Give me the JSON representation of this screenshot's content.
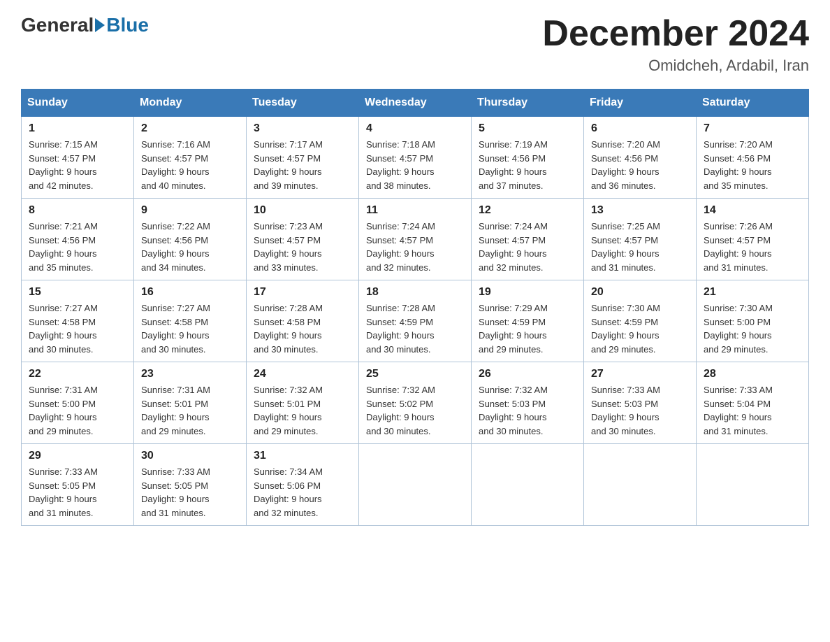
{
  "header": {
    "logo": {
      "general": "General",
      "blue": "Blue"
    },
    "title": "December 2024",
    "location": "Omidcheh, Ardabil, Iran"
  },
  "weekdays": [
    "Sunday",
    "Monday",
    "Tuesday",
    "Wednesday",
    "Thursday",
    "Friday",
    "Saturday"
  ],
  "weeks": [
    [
      {
        "day": "1",
        "sunrise": "7:15 AM",
        "sunset": "4:57 PM",
        "daylight": "9 hours and 42 minutes."
      },
      {
        "day": "2",
        "sunrise": "7:16 AM",
        "sunset": "4:57 PM",
        "daylight": "9 hours and 40 minutes."
      },
      {
        "day": "3",
        "sunrise": "7:17 AM",
        "sunset": "4:57 PM",
        "daylight": "9 hours and 39 minutes."
      },
      {
        "day": "4",
        "sunrise": "7:18 AM",
        "sunset": "4:57 PM",
        "daylight": "9 hours and 38 minutes."
      },
      {
        "day": "5",
        "sunrise": "7:19 AM",
        "sunset": "4:56 PM",
        "daylight": "9 hours and 37 minutes."
      },
      {
        "day": "6",
        "sunrise": "7:20 AM",
        "sunset": "4:56 PM",
        "daylight": "9 hours and 36 minutes."
      },
      {
        "day": "7",
        "sunrise": "7:20 AM",
        "sunset": "4:56 PM",
        "daylight": "9 hours and 35 minutes."
      }
    ],
    [
      {
        "day": "8",
        "sunrise": "7:21 AM",
        "sunset": "4:56 PM",
        "daylight": "9 hours and 35 minutes."
      },
      {
        "day": "9",
        "sunrise": "7:22 AM",
        "sunset": "4:56 PM",
        "daylight": "9 hours and 34 minutes."
      },
      {
        "day": "10",
        "sunrise": "7:23 AM",
        "sunset": "4:57 PM",
        "daylight": "9 hours and 33 minutes."
      },
      {
        "day": "11",
        "sunrise": "7:24 AM",
        "sunset": "4:57 PM",
        "daylight": "9 hours and 32 minutes."
      },
      {
        "day": "12",
        "sunrise": "7:24 AM",
        "sunset": "4:57 PM",
        "daylight": "9 hours and 32 minutes."
      },
      {
        "day": "13",
        "sunrise": "7:25 AM",
        "sunset": "4:57 PM",
        "daylight": "9 hours and 31 minutes."
      },
      {
        "day": "14",
        "sunrise": "7:26 AM",
        "sunset": "4:57 PM",
        "daylight": "9 hours and 31 minutes."
      }
    ],
    [
      {
        "day": "15",
        "sunrise": "7:27 AM",
        "sunset": "4:58 PM",
        "daylight": "9 hours and 30 minutes."
      },
      {
        "day": "16",
        "sunrise": "7:27 AM",
        "sunset": "4:58 PM",
        "daylight": "9 hours and 30 minutes."
      },
      {
        "day": "17",
        "sunrise": "7:28 AM",
        "sunset": "4:58 PM",
        "daylight": "9 hours and 30 minutes."
      },
      {
        "day": "18",
        "sunrise": "7:28 AM",
        "sunset": "4:59 PM",
        "daylight": "9 hours and 30 minutes."
      },
      {
        "day": "19",
        "sunrise": "7:29 AM",
        "sunset": "4:59 PM",
        "daylight": "9 hours and 29 minutes."
      },
      {
        "day": "20",
        "sunrise": "7:30 AM",
        "sunset": "4:59 PM",
        "daylight": "9 hours and 29 minutes."
      },
      {
        "day": "21",
        "sunrise": "7:30 AM",
        "sunset": "5:00 PM",
        "daylight": "9 hours and 29 minutes."
      }
    ],
    [
      {
        "day": "22",
        "sunrise": "7:31 AM",
        "sunset": "5:00 PM",
        "daylight": "9 hours and 29 minutes."
      },
      {
        "day": "23",
        "sunrise": "7:31 AM",
        "sunset": "5:01 PM",
        "daylight": "9 hours and 29 minutes."
      },
      {
        "day": "24",
        "sunrise": "7:32 AM",
        "sunset": "5:01 PM",
        "daylight": "9 hours and 29 minutes."
      },
      {
        "day": "25",
        "sunrise": "7:32 AM",
        "sunset": "5:02 PM",
        "daylight": "9 hours and 30 minutes."
      },
      {
        "day": "26",
        "sunrise": "7:32 AM",
        "sunset": "5:03 PM",
        "daylight": "9 hours and 30 minutes."
      },
      {
        "day": "27",
        "sunrise": "7:33 AM",
        "sunset": "5:03 PM",
        "daylight": "9 hours and 30 minutes."
      },
      {
        "day": "28",
        "sunrise": "7:33 AM",
        "sunset": "5:04 PM",
        "daylight": "9 hours and 31 minutes."
      }
    ],
    [
      {
        "day": "29",
        "sunrise": "7:33 AM",
        "sunset": "5:05 PM",
        "daylight": "9 hours and 31 minutes."
      },
      {
        "day": "30",
        "sunrise": "7:33 AM",
        "sunset": "5:05 PM",
        "daylight": "9 hours and 31 minutes."
      },
      {
        "day": "31",
        "sunrise": "7:34 AM",
        "sunset": "5:06 PM",
        "daylight": "9 hours and 32 minutes."
      },
      null,
      null,
      null,
      null
    ]
  ],
  "labels": {
    "sunrise": "Sunrise:",
    "sunset": "Sunset:",
    "daylight": "Daylight:"
  }
}
